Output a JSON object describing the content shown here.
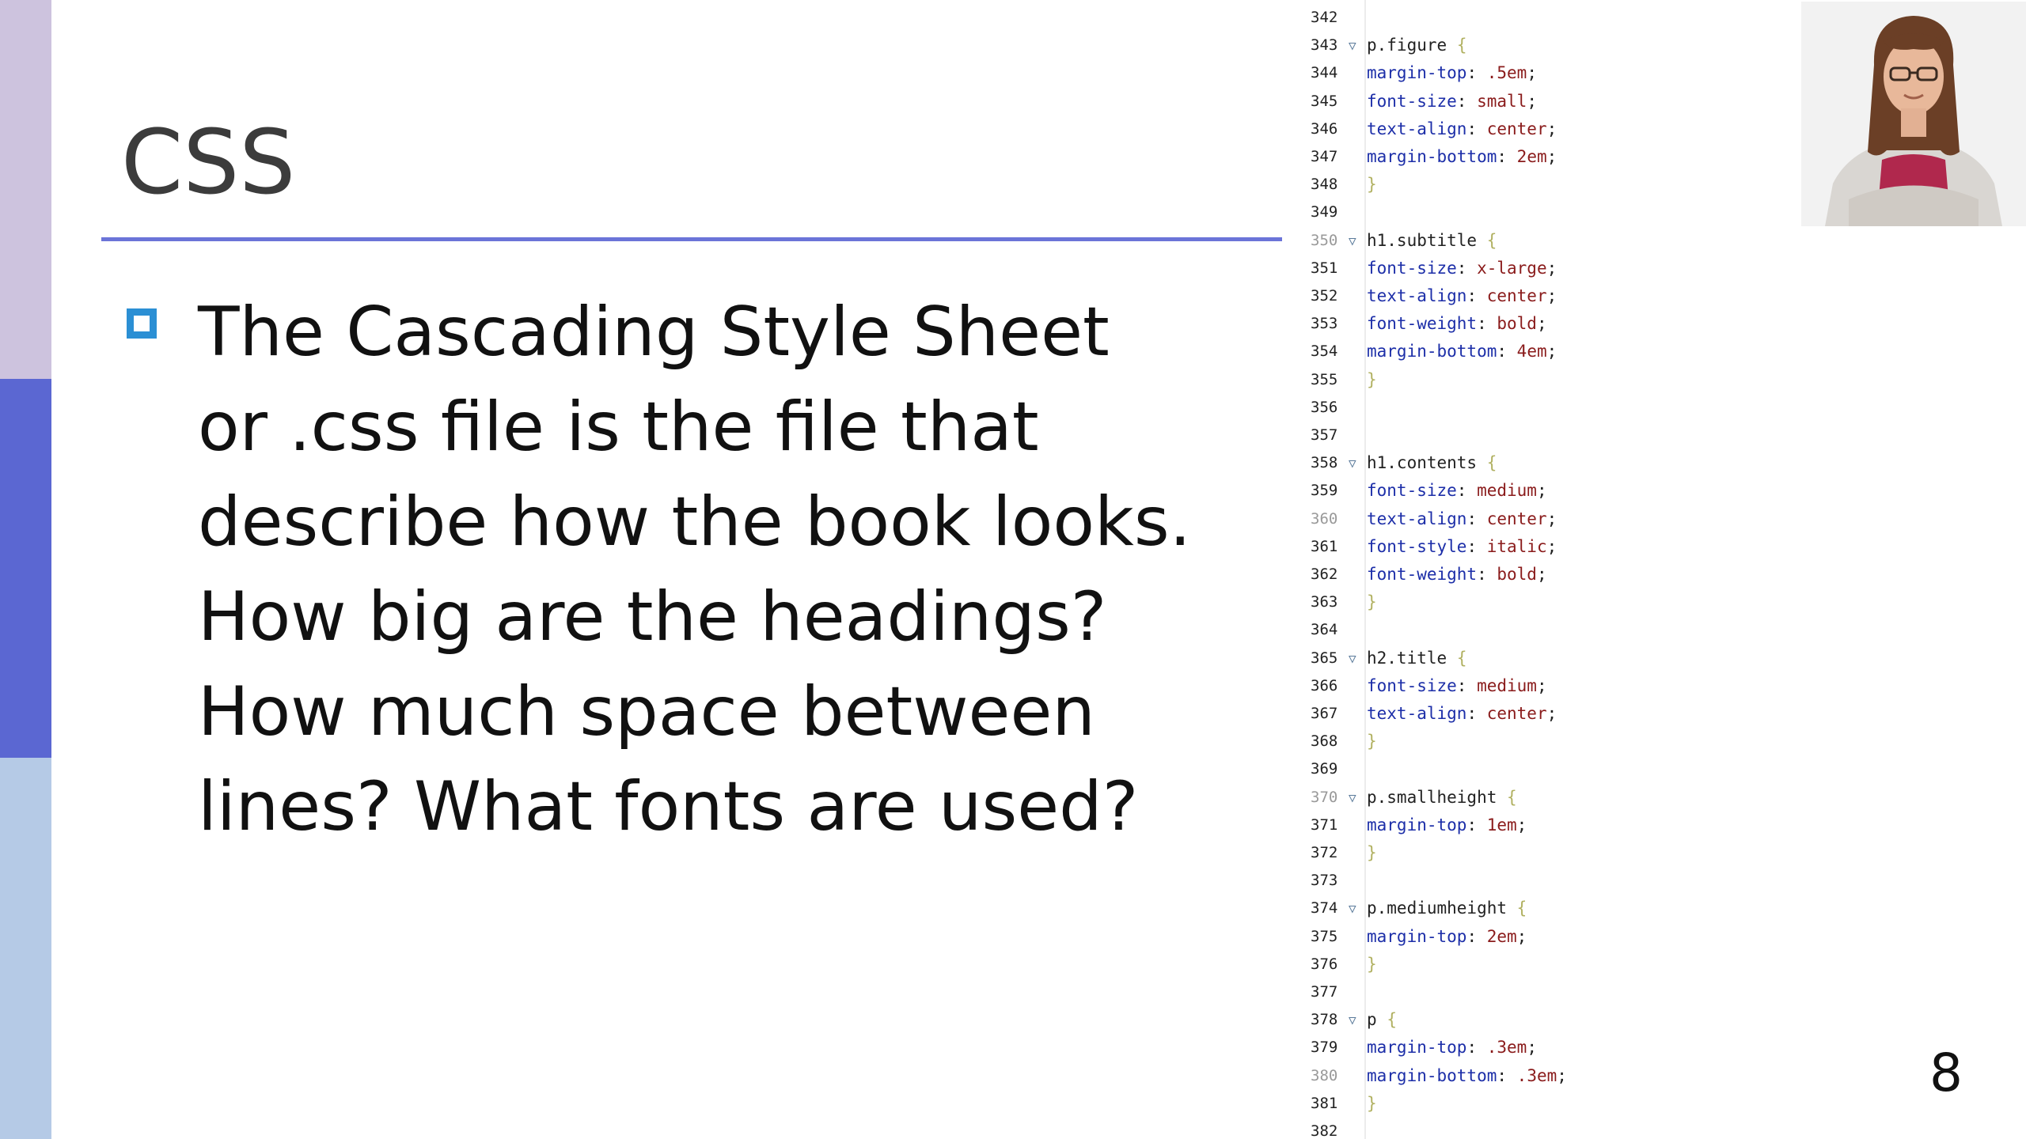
{
  "slide": {
    "title": "CSS",
    "body_lines": [
      "The Cascading Style Sheet",
      "or .css file is the file that",
      "describe how the book looks.",
      "How big are the headings?",
      "How much space between",
      "lines? What fonts are used?"
    ],
    "page_number": "8",
    "colors": {
      "accent_top": "#cdc3de",
      "accent_mid": "#5b67d2",
      "accent_bottom": "#b5cae6",
      "title_rule": "#6b74d8",
      "bullet": "#2b8fd4"
    }
  },
  "code_editor": {
    "lines": [
      {
        "n": "342",
        "sel": "",
        "prop": "",
        "val": "",
        "brace": ""
      },
      {
        "n": "343",
        "fold": true,
        "sel": "p.figure",
        "brace": "{"
      },
      {
        "n": "344",
        "prop": "margin-top",
        "val": ".5em"
      },
      {
        "n": "345",
        "prop": "font-size",
        "val": "small"
      },
      {
        "n": "346",
        "prop": "text-align",
        "val": "center"
      },
      {
        "n": "347",
        "prop": "margin-bottom",
        "val": "2em"
      },
      {
        "n": "348",
        "brace": "}"
      },
      {
        "n": "349"
      },
      {
        "n": "350",
        "dim": true,
        "fold": true,
        "sel": "h1.subtitle",
        "brace": "{"
      },
      {
        "n": "351",
        "prop": "font-size",
        "val": "x-large"
      },
      {
        "n": "352",
        "prop": "text-align",
        "val": "center"
      },
      {
        "n": "353",
        "prop": "font-weight",
        "val": "bold"
      },
      {
        "n": "354",
        "prop": "margin-bottom",
        "val": "4em"
      },
      {
        "n": "355",
        "brace": "}"
      },
      {
        "n": "356"
      },
      {
        "n": "357"
      },
      {
        "n": "358",
        "fold": true,
        "sel": "h1.contents",
        "brace": "{"
      },
      {
        "n": "359",
        "prop": "font-size",
        "val": "medium"
      },
      {
        "n": "360",
        "dim": true,
        "prop": "text-align",
        "val": "center"
      },
      {
        "n": "361",
        "prop": "font-style",
        "val": "italic"
      },
      {
        "n": "362",
        "prop": "font-weight",
        "val": "bold"
      },
      {
        "n": "363",
        "brace": "}"
      },
      {
        "n": "364"
      },
      {
        "n": "365",
        "fold": true,
        "sel": "h2.title",
        "brace": "{"
      },
      {
        "n": "366",
        "prop": "font-size",
        "val": "medium"
      },
      {
        "n": "367",
        "prop": "text-align",
        "val": "center"
      },
      {
        "n": "368",
        "brace": "}"
      },
      {
        "n": "369"
      },
      {
        "n": "370",
        "dim": true,
        "fold": true,
        "sel": "p.smallheight",
        "brace": "{"
      },
      {
        "n": "371",
        "prop": "margin-top",
        "val": "1em"
      },
      {
        "n": "372",
        "brace": "}"
      },
      {
        "n": "373"
      },
      {
        "n": "374",
        "fold": true,
        "sel": "p.mediumheight",
        "brace": "{"
      },
      {
        "n": "375",
        "prop": "margin-top",
        "val": "2em"
      },
      {
        "n": "376",
        "brace": "}"
      },
      {
        "n": "377"
      },
      {
        "n": "378",
        "fold": true,
        "sel": "p",
        "brace": "{"
      },
      {
        "n": "379",
        "prop": "margin-top",
        "val": ".3em"
      },
      {
        "n": "380",
        "dim": true,
        "prop": "margin-bottom",
        "val": ".3em"
      },
      {
        "n": "381",
        "brace": "}"
      },
      {
        "n": "382"
      }
    ]
  },
  "presenter": {
    "icon": "person-avatar-icon"
  }
}
